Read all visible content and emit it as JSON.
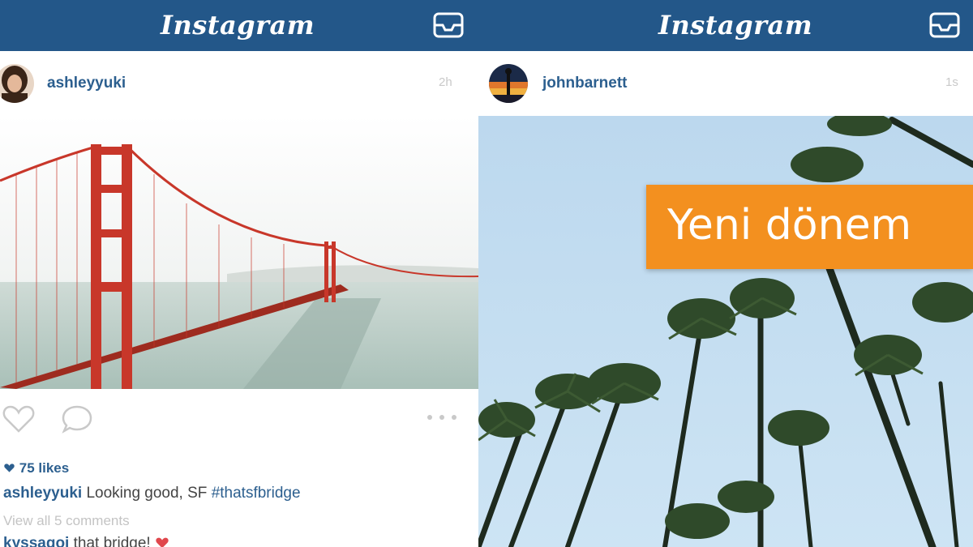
{
  "brand_color": "#235789",
  "left": {
    "app_title": "Instagram",
    "inbox_icon": "inbox-icon",
    "post": {
      "username": "ashleyyuki",
      "timestamp": "2h",
      "likes_icon": "heart-icon",
      "likes": "75 likes",
      "caption_user": "ashleyyuki",
      "caption_text": "Looking good, SF",
      "caption_tag": "#thatsfbridge",
      "view_comments": "View all 5 comments",
      "comment_user": "kyssagoi",
      "comment_text": "that bridge!"
    }
  },
  "right": {
    "app_title": "Instagram",
    "inbox_icon": "inbox-icon",
    "post": {
      "username": "johnbarnett",
      "timestamp": "1s"
    }
  },
  "banner": {
    "text": "Yeni dönem",
    "color": "#f3901f"
  }
}
